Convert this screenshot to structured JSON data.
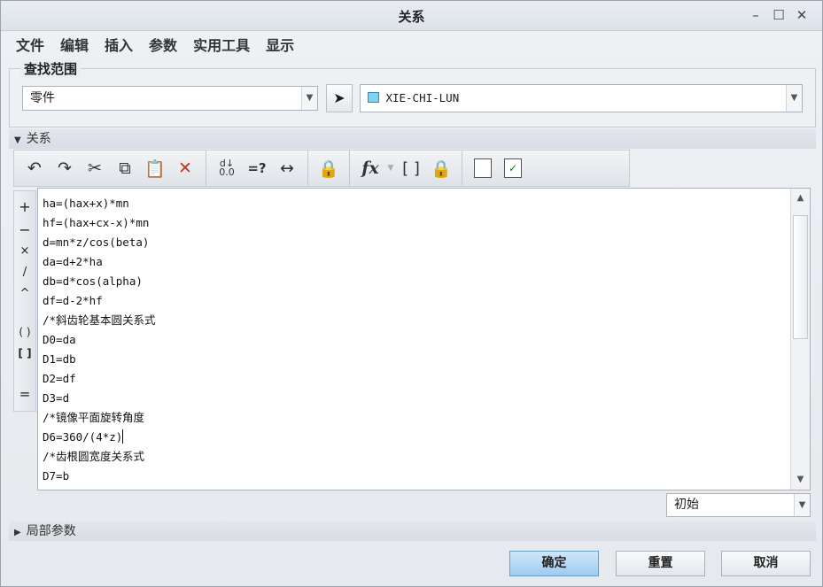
{
  "window": {
    "title": "关系"
  },
  "menu": [
    "文件",
    "编辑",
    "插入",
    "参数",
    "实用工具",
    "显示"
  ],
  "search_scope": {
    "label": "查找范围",
    "type_value": "零件",
    "model_value": "XIE-CHI-LUN"
  },
  "relations_section": {
    "label": "关系"
  },
  "editor": {
    "lines": [
      "ha=(hax+x)*mn",
      "hf=(hax+cx-x)*mn",
      "d=mn*z/cos(beta)",
      "da=d+2*ha",
      "db=d*cos(alpha)",
      "df=d-2*hf",
      "/*斜齿轮基本圆关系式",
      "D0=da",
      "D1=db",
      "D2=df",
      "D3=d",
      "/*镜像平面旋转角度",
      "D6=360/(4*z)",
      "/*齿根圆宽度关系式",
      "D7=b"
    ]
  },
  "operators": [
    "+",
    "−",
    "×",
    "/",
    "^",
    "( )",
    "[ ]",
    "="
  ],
  "sort_select": {
    "value": "初始"
  },
  "local_params_section": {
    "label": "局部参数"
  },
  "buttons": {
    "ok": "确定",
    "reset": "重置",
    "cancel": "取消"
  },
  "toolbar": {
    "compare": "=?"
  }
}
